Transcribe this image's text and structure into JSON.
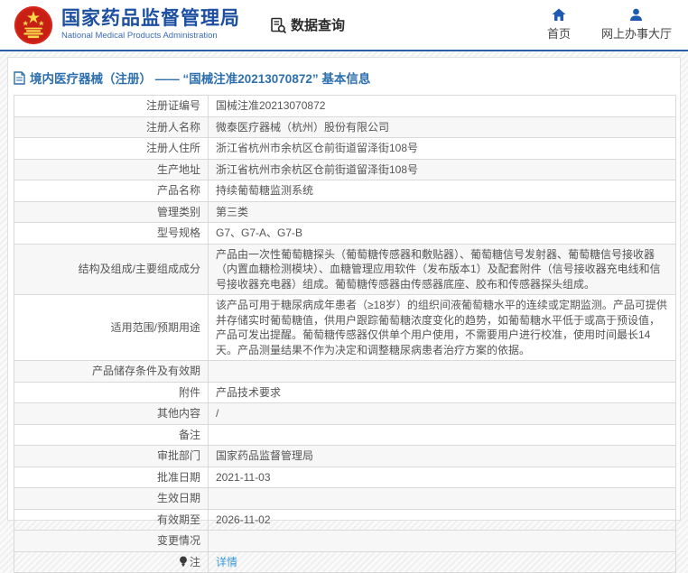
{
  "header": {
    "agency_name_cn": "国家药品监督管理局",
    "agency_name_en": "National Medical Products Administration",
    "data_query_label": "数据查询",
    "home_label": "首页",
    "service_hall_label": "网上办事大厅"
  },
  "page": {
    "title": "境内医疗器械（注册） —— “国械注准20213070872” 基本信息"
  },
  "icons": {
    "national_emblem": "red-circle-gold-emblem",
    "data_query": "document-with-magnifier",
    "home": "house",
    "service_hall": "person",
    "page_title": "document",
    "note": "lightbulb"
  },
  "colors": {
    "brand_blue": "#1c4fa1",
    "nav_icon_blue": "#1e5bb0",
    "page_title_blue": "#2e6fae",
    "link_blue": "#3a9ad9",
    "emblem_red": "#d8261b",
    "header_divider_blue": "#2b5fa7"
  },
  "table": {
    "rows": [
      {
        "label": "注册证编号",
        "value": "国械注准20213070872"
      },
      {
        "label": "注册人名称",
        "value": "微泰医疗器械（杭州）股份有限公司"
      },
      {
        "label": "注册人住所",
        "value": "浙江省杭州市余杭区仓前街道留泽街108号"
      },
      {
        "label": "生产地址",
        "value": "浙江省杭州市余杭区仓前街道留泽街108号"
      },
      {
        "label": "产品名称",
        "value": "持续葡萄糖监测系统"
      },
      {
        "label": "管理类别",
        "value": "第三类"
      },
      {
        "label": "型号规格",
        "value": "G7、G7-A、G7-B"
      },
      {
        "label": "结构及组成/主要组成成分",
        "value": "产品由一次性葡萄糖探头（葡萄糖传感器和敷贴器）、葡萄糖信号发射器、葡萄糖信号接收器（内置血糖检测模块）、血糖管理应用软件（发布版本1）及配套附件（信号接收器充电线和信号接收器充电器）组成。葡萄糖传感器由传感器底座、胶布和传感器探头组成。"
      },
      {
        "label": "适用范围/预期用途",
        "value": "该产品可用于糖尿病成年患者（≥18岁）的组织间液葡萄糖水平的连续或定期监测。产品可提供并存储实时葡萄糖值，供用户跟踪葡萄糖浓度变化的趋势，如葡萄糖水平低于或高于预设值，产品可发出提醒。葡萄糖传感器仅供单个用户使用，不需要用户进行校准，使用时间最长14天。产品测量结果不作为决定和调整糖尿病患者治疗方案的依据。"
      },
      {
        "label": "产品储存条件及有效期",
        "value": ""
      },
      {
        "label": "附件",
        "value": "产品技术要求"
      },
      {
        "label": "其他内容",
        "value": "/"
      },
      {
        "label": "备注",
        "value": ""
      },
      {
        "label": "审批部门",
        "value": "国家药品监督管理局"
      },
      {
        "label": "批准日期",
        "value": "2021-11-03"
      },
      {
        "label": "生效日期",
        "value": ""
      },
      {
        "label": "有效期至",
        "value": "2026-11-02"
      },
      {
        "label": "变更情况",
        "value": ""
      },
      {
        "label": "注",
        "value": "详情",
        "label_icon": "bulb-icon",
        "value_is_link": true
      }
    ]
  }
}
